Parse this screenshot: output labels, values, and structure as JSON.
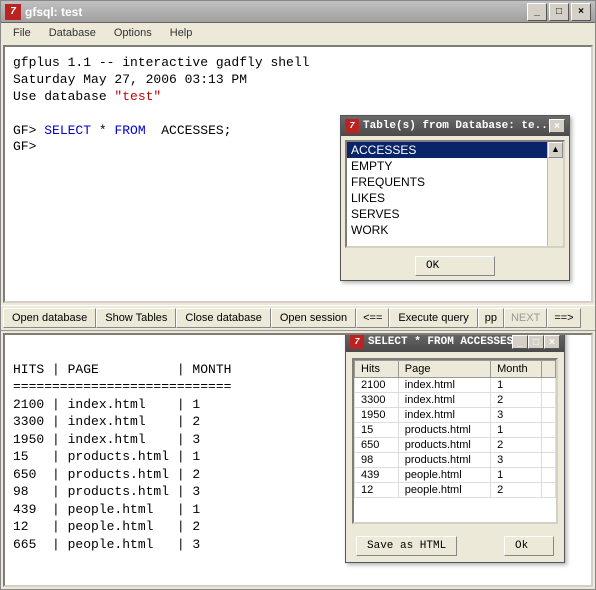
{
  "window": {
    "title": "gfsql: test"
  },
  "menu": [
    "File",
    "Database",
    "Options",
    "Help"
  ],
  "shell": {
    "banner1": "gfplus 1.1 -- interactive gadfly shell",
    "banner2": "Saturday May 27, 2006 03:13 PM",
    "use_prefix": "Use database ",
    "use_db": "\"test\"",
    "prompt": "GF>",
    "sql_select": "SELECT",
    "sql_rest": " * ",
    "sql_from": "FROM",
    "sql_table": "  ACCESSES;"
  },
  "toolbar": {
    "open_db": "Open database",
    "show_tables": "Show Tables",
    "close_db": "Close database",
    "open_session": "Open session",
    "back": "<==",
    "exec": "Execute query",
    "pp": "pp",
    "next": "NEXT",
    "fwd": "==>"
  },
  "results_text": {
    "header": "HITS | PAGE          | MONTH",
    "sep": "============================",
    "rows": [
      "2100 | index.html    | 1",
      "3300 | index.html    | 2",
      "1950 | index.html    | 3",
      "15   | products.html | 1",
      "650  | products.html | 2",
      "98   | products.html | 3",
      "439  | people.html   | 1",
      "12   | people.html   | 2",
      "665  | people.html   | 3"
    ]
  },
  "tables_popup": {
    "title": "Table(s) from Database: te...",
    "items": [
      "ACCESSES",
      "EMPTY",
      "FREQUENTS",
      "LIKES",
      "SERVES",
      "WORK"
    ],
    "ok": "OK"
  },
  "result_popup": {
    "title": "SELECT * FROM  ACCESSES;",
    "columns": [
      "Hits",
      "Page",
      "Month"
    ],
    "rows": [
      [
        "2100",
        "index.html",
        "1"
      ],
      [
        "3300",
        "index.html",
        "2"
      ],
      [
        "1950",
        "index.html",
        "3"
      ],
      [
        "15",
        "products.html",
        "1"
      ],
      [
        "650",
        "products.html",
        "2"
      ],
      [
        "98",
        "products.html",
        "3"
      ],
      [
        "439",
        "people.html",
        "1"
      ],
      [
        "12",
        "people.html",
        "2"
      ]
    ],
    "save": "Save as HTML",
    "ok": "Ok"
  }
}
